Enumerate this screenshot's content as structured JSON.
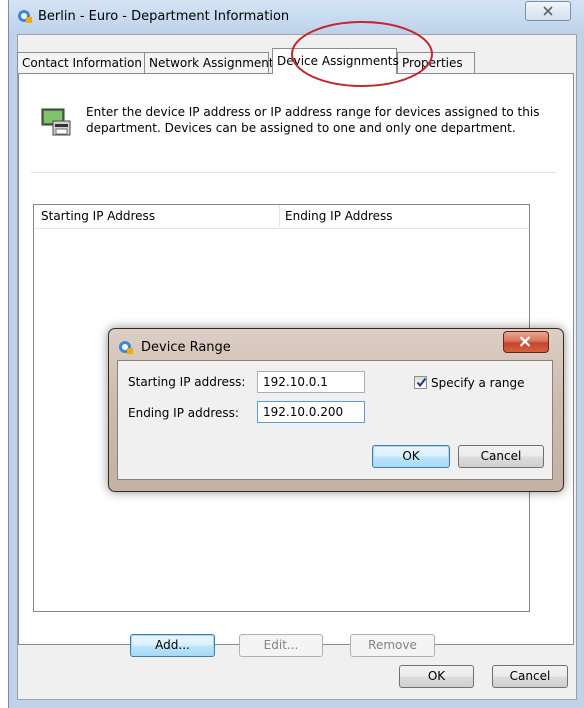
{
  "window": {
    "title": "Berlin - Euro - Department Information"
  },
  "tabs": [
    {
      "label": "Contact Information",
      "active": false
    },
    {
      "label": "Network Assignments",
      "active": false
    },
    {
      "label": "Device Assignments",
      "active": true
    },
    {
      "label": "Properties",
      "active": false
    }
  ],
  "panel": {
    "intro": "Enter the device IP address or IP address range for devices assigned to this department. Devices can be assigned to one and only one department.",
    "columns": [
      "Starting IP Address",
      "Ending IP Address"
    ],
    "buttons": {
      "add": "Add...",
      "edit": "Edit...",
      "remove": "Remove"
    }
  },
  "footer": {
    "ok": "OK",
    "cancel": "Cancel"
  },
  "dialog": {
    "title": "Device Range",
    "start_label": "Starting IP address:",
    "start_value": "192.10.0.1",
    "end_label": "Ending IP address:",
    "end_value": "192.10.0.200",
    "range_label": "Specify a range",
    "range_checked": true,
    "ok": "OK",
    "cancel": "Cancel"
  },
  "colors": {
    "annotation": "#c4262e",
    "title_bar": "#bcd2ea",
    "dialog_frame": "#c2b1a5"
  }
}
